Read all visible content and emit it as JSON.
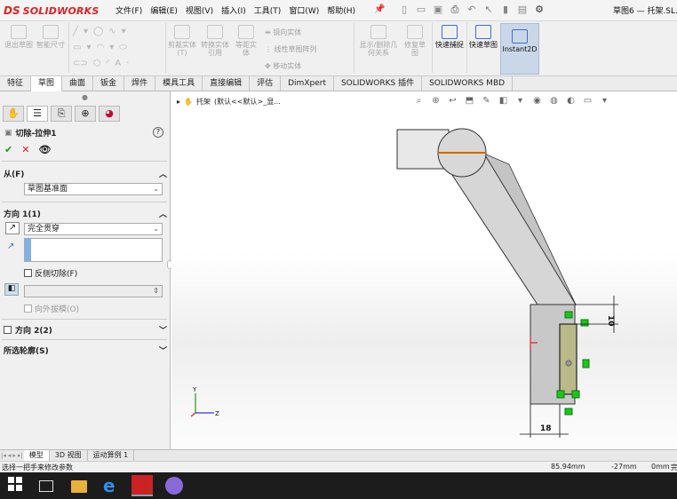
{
  "app": {
    "brand_ds": "DS",
    "brand_name": "SOLIDWORKS"
  },
  "menu": [
    "文件(F)",
    "编辑(E)",
    "视图(V)",
    "插入(I)",
    "工具(T)",
    "窗口(W)",
    "帮助(H)"
  ],
  "window_title": "草图6 — 托架.SL...",
  "ribbon": {
    "exit_sketch": "退出草图",
    "smart_dim": "智能尺寸",
    "trim": "剪裁实体(T)",
    "convert": "转换实体引用",
    "offset": "等距实体",
    "mirror": "镜向实体",
    "linear_pattern": "线性草图阵列",
    "move": "移动实体",
    "relations": "显示/删除几何关系",
    "repair": "修复草图",
    "quick_snap": "快速捕捉",
    "rapid_sketch": "快速草图",
    "instant2d": "Instant2D"
  },
  "tabs": [
    "特征",
    "草图",
    "曲面",
    "钣金",
    "焊件",
    "模具工具",
    "直接编辑",
    "评估",
    "DimXpert",
    "SOLIDWORKS 插件",
    "SOLIDWORKS MBD"
  ],
  "active_tab": "草图",
  "pm": {
    "title": "切除-拉伸1",
    "help": "?",
    "ok": "✔",
    "cancel": "✕",
    "from_label": "从(F)",
    "from_value": "草图基准面",
    "dir1_label": "方向 1(1)",
    "end_condition": "完全贯穿",
    "flip_side": "反侧切除(F)",
    "draft_outward": "向外拔模(O)",
    "dir2_label": "方向 2(2)",
    "contours_label": "所选轮廓(S)"
  },
  "tree": {
    "part": "托架",
    "config": "(默认<<默认>_显..."
  },
  "dims": {
    "top": "10",
    "bottom": "18"
  },
  "axes": {
    "y": "Y",
    "z": "Z"
  },
  "bottom_tabs": [
    "模型",
    "3D 视图",
    "运动算例 1"
  ],
  "status": {
    "hint": "选择一把手来修改参数",
    "x": "85.94mm",
    "y": "-27mm",
    "z": "0mm",
    "state": "完"
  }
}
